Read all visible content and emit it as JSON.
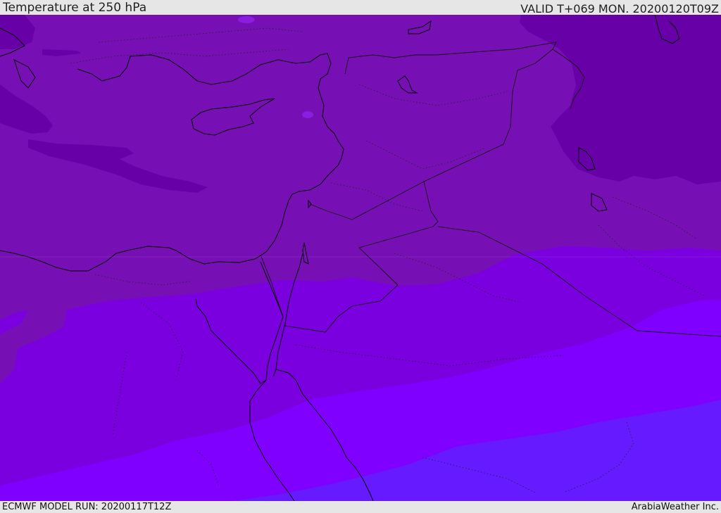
{
  "header": {
    "title": "Temperature at 250 hPa",
    "valid_time": "VALID T+069 MON. 20200120T09Z"
  },
  "footer": {
    "model_run": "ECMWF MODEL RUN: 20200117T12Z",
    "credit": "ArabiaWeather Inc."
  },
  "map": {
    "colors": {
      "darkest": "#6800a8",
      "dark": "#7710b4",
      "medium_dark": "#7a0fc4",
      "medium": "#7a00e0",
      "bright": "#7f00ff",
      "blue": "#661aff",
      "coastline": "#000000",
      "border": "#111111"
    }
  }
}
